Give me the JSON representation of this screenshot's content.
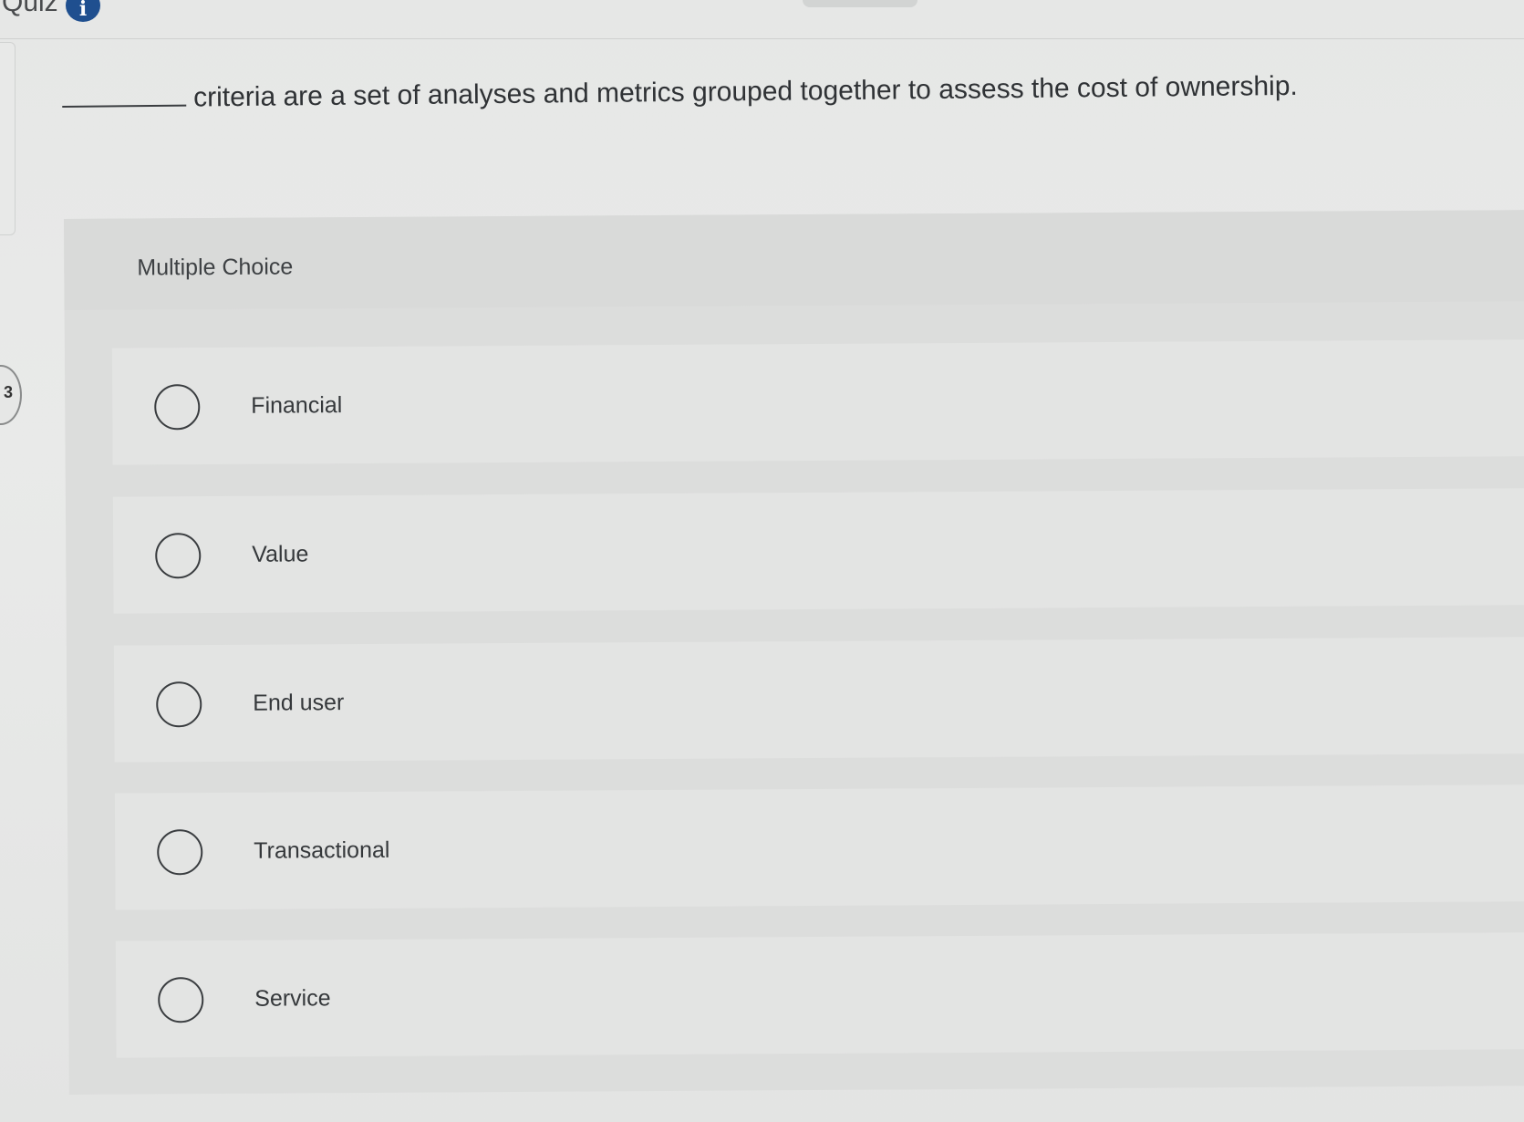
{
  "header": {
    "title": "Quiz",
    "info_icon": "i"
  },
  "side_badge": "3",
  "question": {
    "text": "criteria are a set of analyses and metrics grouped together to assess the cost of ownership."
  },
  "panel": {
    "type_label": "Multiple Choice",
    "options": [
      {
        "label": "Financial"
      },
      {
        "label": "Value"
      },
      {
        "label": "End user"
      },
      {
        "label": "Transactional"
      },
      {
        "label": "Service"
      }
    ]
  }
}
